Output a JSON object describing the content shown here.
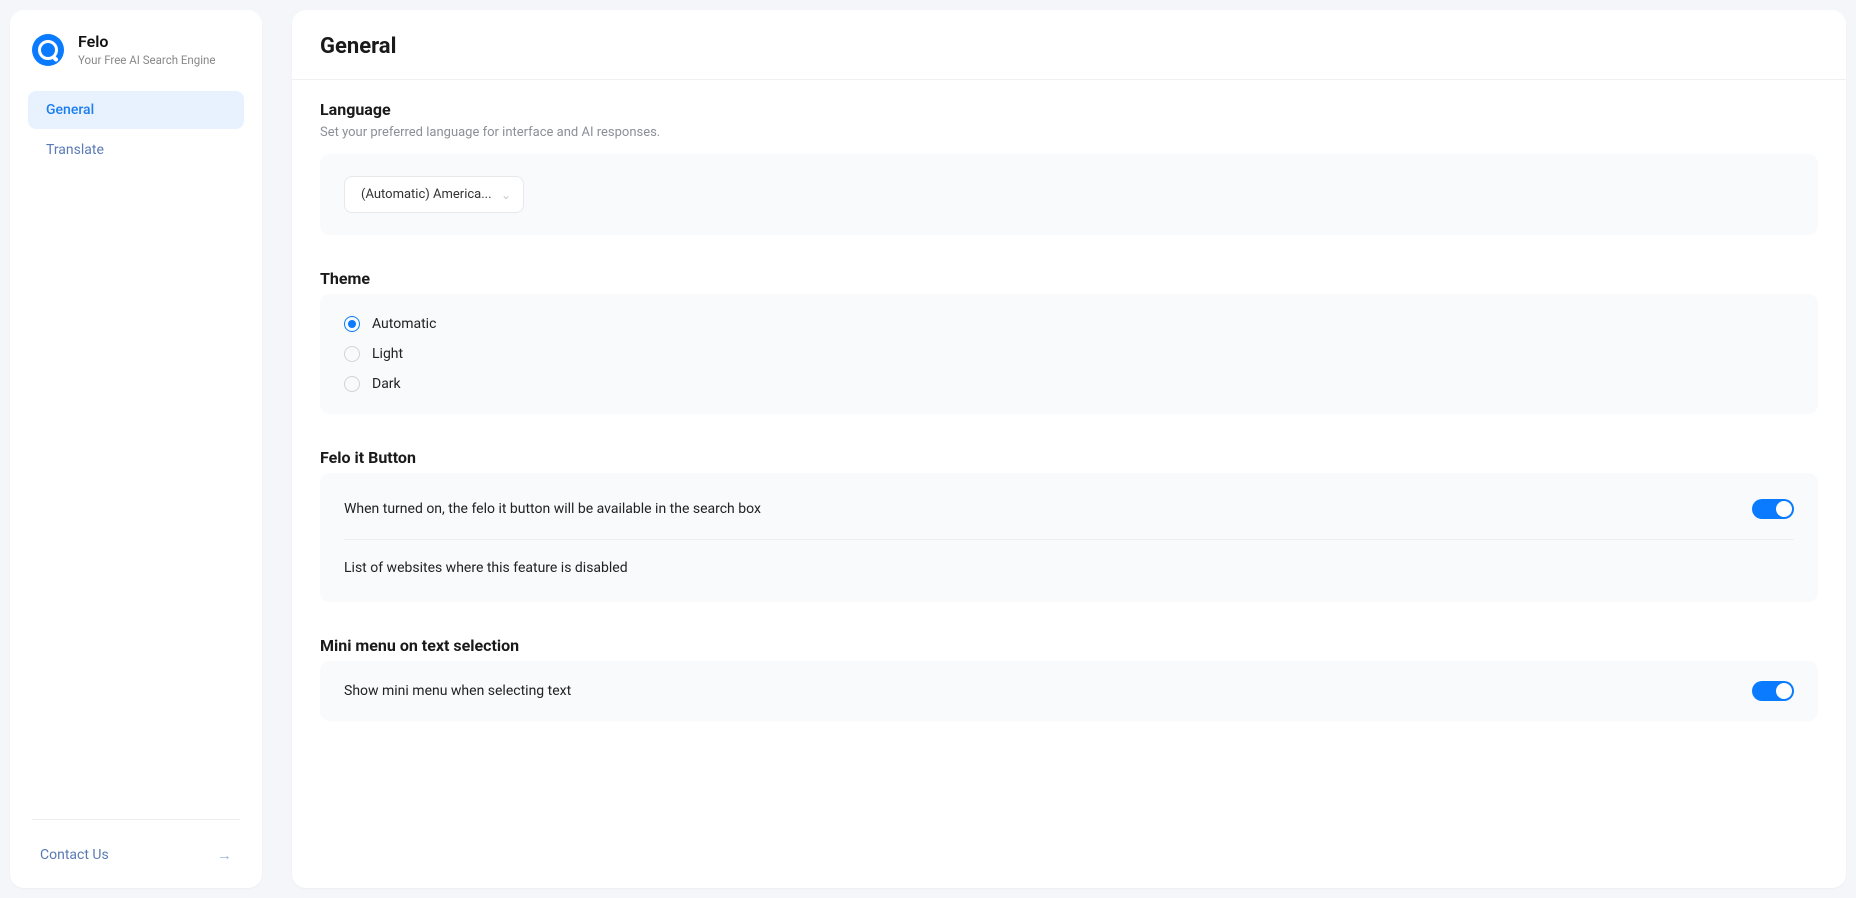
{
  "brand": {
    "title": "Felo",
    "subtitle": "Your Free AI Search Engine"
  },
  "sidebar": {
    "items": [
      {
        "label": "General",
        "active": true
      },
      {
        "label": "Translate",
        "active": false
      }
    ],
    "contact": "Contact Us"
  },
  "main": {
    "title": "General"
  },
  "language": {
    "title": "Language",
    "subtitle": "Set your preferred language for interface and AI responses.",
    "selected": "(Automatic) America..."
  },
  "theme": {
    "title": "Theme",
    "options": [
      {
        "label": "Automatic",
        "checked": true
      },
      {
        "label": "Light",
        "checked": false
      },
      {
        "label": "Dark",
        "checked": false
      }
    ]
  },
  "felo_button": {
    "title": "Felo it Button",
    "desc": "When turned on, the felo it button will be available in the search box",
    "enabled": true,
    "disabled_list_label": "List of websites where this feature is disabled"
  },
  "mini_menu": {
    "title": "Mini menu on text selection",
    "desc": "Show mini menu when selecting text",
    "enabled": true
  }
}
